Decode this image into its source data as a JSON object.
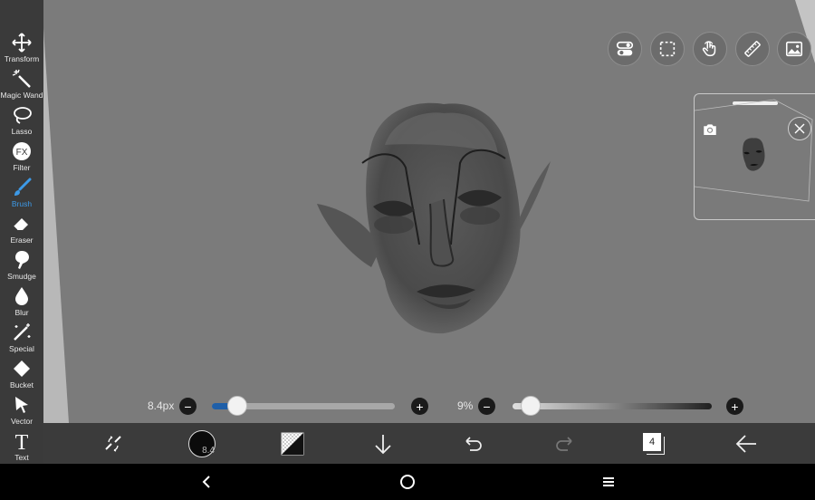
{
  "toolbar": {
    "tools": [
      {
        "label": "Transform",
        "icon": "move-arrows-icon"
      },
      {
        "label": "Magic Wand",
        "icon": "magic-wand-icon"
      },
      {
        "label": "Lasso",
        "icon": "lasso-icon"
      },
      {
        "label": "Filter",
        "icon": "fx-icon"
      },
      {
        "label": "Brush",
        "icon": "brush-icon",
        "active": true
      },
      {
        "label": "Eraser",
        "icon": "eraser-icon"
      },
      {
        "label": "Smudge",
        "icon": "smudge-icon"
      },
      {
        "label": "Blur",
        "icon": "blur-drop-icon"
      },
      {
        "label": "Special",
        "icon": "special-wand-icon"
      },
      {
        "label": "Bucket",
        "icon": "bucket-icon"
      },
      {
        "label": "Vector",
        "icon": "cursor-arrow-icon"
      },
      {
        "label": "Text",
        "icon": "text-t-icon"
      }
    ],
    "filter_glyph": "FX",
    "text_glyph": "T"
  },
  "top_actions": [
    "toggle-settings-icon",
    "selection-icon",
    "hand-touch-icon",
    "ruler-icon",
    "image-icon"
  ],
  "sliders": {
    "size_label": "8.4px",
    "size_fraction": 0.14,
    "opacity_label": "9%",
    "opacity_fraction": 0.09
  },
  "bottombar": {
    "brush_size_badge": "8.4",
    "layer_count": "4"
  },
  "colors": {
    "accent": "#3d9ae8",
    "toolbar_bg": "#3a3a3a",
    "canvas_bg": "#7b7b7b",
    "slider_fill": "#1f5fa8"
  }
}
